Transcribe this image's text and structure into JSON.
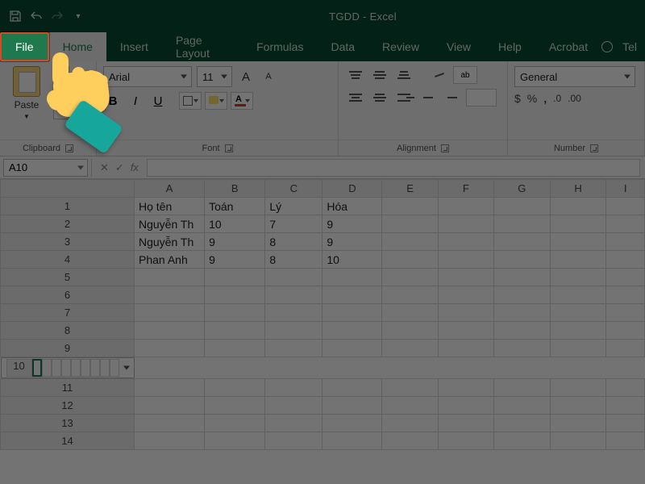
{
  "app": {
    "title": "TGDD  -  Excel"
  },
  "qat": {
    "save": "save-icon",
    "undo": "undo-icon",
    "redo": "redo-icon"
  },
  "tabs": {
    "file": "File",
    "items": [
      "Home",
      "Insert",
      "Page Layout",
      "Formulas",
      "Data",
      "Review",
      "View",
      "Help",
      "Acrobat"
    ],
    "tell": "Tel"
  },
  "ribbon": {
    "clipboard": {
      "label": "Clipboard",
      "paste": "Paste"
    },
    "font": {
      "label": "Font",
      "name": "Arial",
      "size": "11",
      "grow": "A",
      "shrink": "A",
      "bold": "B",
      "italic": "I",
      "underline": "U",
      "fontcolor_letter": "A"
    },
    "alignment": {
      "label": "Alignment",
      "wrap": "ab"
    },
    "number": {
      "label": "Number",
      "format": "General",
      "currency": "$",
      "percent": "%",
      "comma": ",",
      "inc": ".0→.00",
      "dec": ".00→.0"
    }
  },
  "namebox": "A10",
  "fx": {
    "cancel": "✕",
    "enter": "✓",
    "label": "fx"
  },
  "columns": [
    "A",
    "B",
    "C",
    "D",
    "E",
    "F",
    "G",
    "H",
    "I"
  ],
  "row_headers": [
    "1",
    "2",
    "3",
    "4",
    "5",
    "6",
    "7",
    "8",
    "9",
    "10",
    "11",
    "12",
    "13",
    "14"
  ],
  "cells": {
    "r1": {
      "A": "Họ tên",
      "B": "Toán",
      "C": "Lý",
      "D": "Hóa"
    },
    "r2": {
      "A": "Nguyễn Th",
      "B": "10",
      "C": "7",
      "D": "9"
    },
    "r3": {
      "A": "Nguyễn Th",
      "B": "9",
      "C": "8",
      "D": "9"
    },
    "r4": {
      "A": "Phan Anh",
      "B": "9",
      "C": "8",
      "D": "10"
    }
  },
  "selected_cell": "A10",
  "annotation": {
    "highlighted_tab": "File"
  }
}
